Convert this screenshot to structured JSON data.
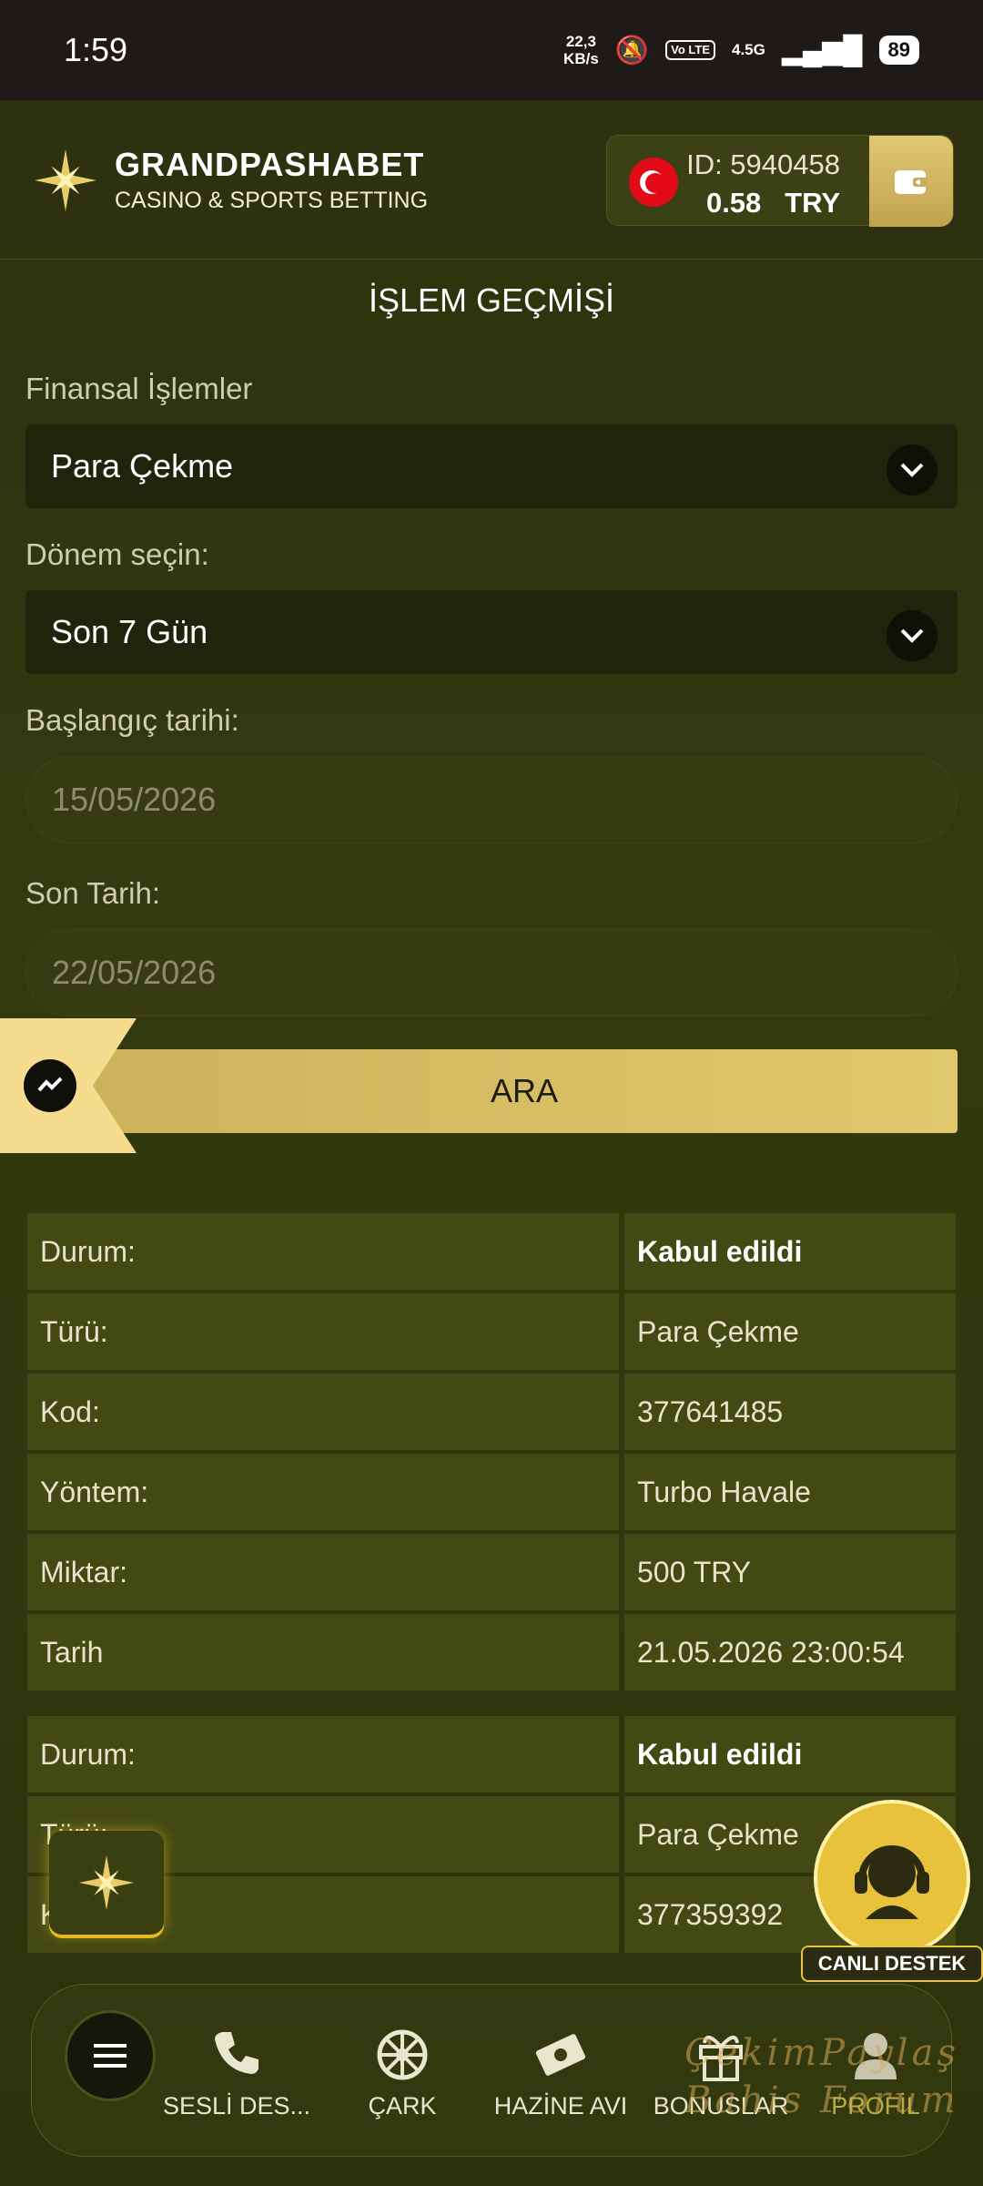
{
  "status_bar": {
    "time": "1:59",
    "speed_value": "22,3",
    "speed_unit": "KB/s",
    "volte": "Vo LTE",
    "network": "4.5G",
    "battery": "89"
  },
  "header": {
    "brand": "GRANDPASHABET",
    "tagline": "CASINO & SPORTS BETTING",
    "account_id": "ID: 5940458",
    "balance": "0.58",
    "currency": "TRY"
  },
  "page_title": "İŞLEM GEÇMİŞİ",
  "form": {
    "type_label": "Finansal İşlemler",
    "type_value": "Para Çekme",
    "period_label": "Dönem seçin:",
    "period_value": "Son 7 Gün",
    "start_label": "Başlangıç tarihi:",
    "start_value": "15/05/2026",
    "end_label": "Son Tarih:",
    "end_value": "22/05/2026",
    "search_label": "ARA"
  },
  "transactions": [
    {
      "rows": [
        {
          "label": "Durum:",
          "value": "Kabul edildi"
        },
        {
          "label": "Türü:",
          "value": "Para Çekme"
        },
        {
          "label": "Kod:",
          "value": "377641485"
        },
        {
          "label": "Yöntem:",
          "value": "Turbo Havale"
        },
        {
          "label": "Miktar:",
          "value": "500 TRY"
        },
        {
          "label": "Tarih",
          "value": "21.05.2026 23:00:54"
        }
      ]
    },
    {
      "rows": [
        {
          "label": "Durum:",
          "value": "Kabul edildi"
        },
        {
          "label": "Türü:",
          "value": "Para Çekme"
        },
        {
          "label": "Kod:",
          "value": "377359392"
        }
      ]
    }
  ],
  "live_support": "CANLI DESTEK",
  "nav": {
    "phone": "SESLİ DES...",
    "wheel": "ÇARK",
    "treasure": "HAZİNE AVI",
    "bonus": "BONUSLAR",
    "profile": "PROFİL"
  },
  "watermark": "ÇekimPaylaş Bahis Forum",
  "colors": {
    "accent_gold": "#d9bf66",
    "background": "#2f340d",
    "row": "#424912"
  }
}
